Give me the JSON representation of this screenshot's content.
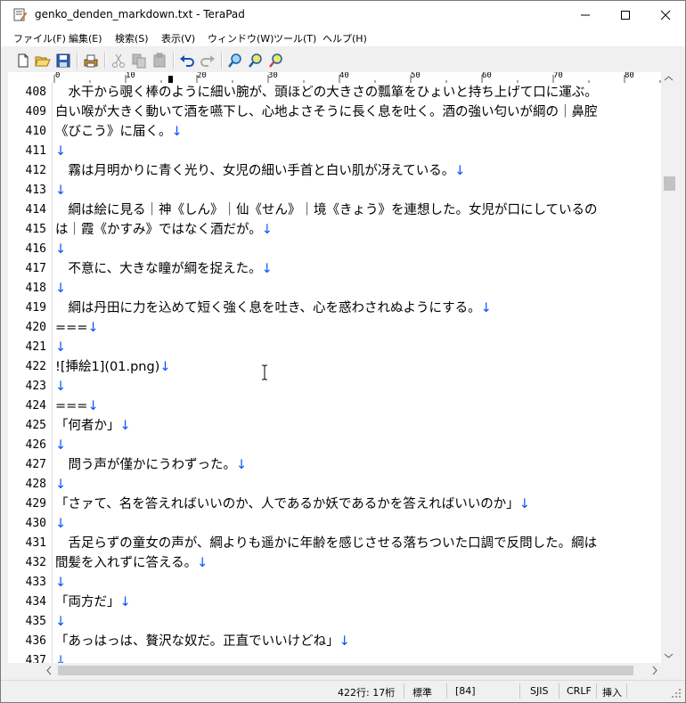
{
  "window": {
    "title": "genko_denden_markdown.txt - TeraPad",
    "buttons": {
      "minimize": "─",
      "maximize": "☐",
      "close": "✕"
    }
  },
  "menu": {
    "items": [
      {
        "label": "ファイル(F)"
      },
      {
        "label": "編集(E)"
      },
      {
        "label": "検索(S)"
      },
      {
        "label": "表示(V)"
      },
      {
        "label": "ウィンドウ(W)"
      },
      {
        "label": "ツール(T)"
      },
      {
        "label": "ヘルプ(H)"
      }
    ]
  },
  "toolbar": {
    "icons": [
      "new-file-icon",
      "open-folder-icon",
      "save-icon",
      "print-icon",
      "cut-icon",
      "copy-icon",
      "paste-icon",
      "undo-icon",
      "redo-icon",
      "search-icon",
      "search-next-icon",
      "search-prev-icon"
    ]
  },
  "ruler": {
    "ticks": [
      "0",
      "10",
      "20",
      "30",
      "40",
      "50",
      "60",
      "70",
      "80"
    ]
  },
  "editor": {
    "lines": [
      {
        "num": "408",
        "text": "　水干から覗く棒のように細い腕が、頭ほどの大きさの瓢箪をひょいと持ち上げて口に運ぶ。",
        "mark": ""
      },
      {
        "num": "409",
        "text": "白い喉が大きく動いて酒を嚥下し、心地よさそうに長く息を吐く。酒の強い匂いが綱の｜鼻腔",
        "mark": ""
      },
      {
        "num": "410",
        "text": "《びこう》に届く。",
        "mark": "↓"
      },
      {
        "num": "411",
        "text": "",
        "mark": "↓"
      },
      {
        "num": "412",
        "text": "　霧は月明かりに青く光り、女児の細い手首と白い肌が冴えている。",
        "mark": "↓"
      },
      {
        "num": "413",
        "text": "",
        "mark": "↓"
      },
      {
        "num": "414",
        "text": "　綱は絵に見る｜神《しん》｜仙《せん》｜境《きょう》を連想した。女児が口にしているの",
        "mark": ""
      },
      {
        "num": "415",
        "text": "は｜霞《かすみ》ではなく酒だが。",
        "mark": "↓"
      },
      {
        "num": "416",
        "text": "",
        "mark": "↓"
      },
      {
        "num": "417",
        "text": "　不意に、大きな瞳が綱を捉えた。",
        "mark": "↓"
      },
      {
        "num": "418",
        "text": "",
        "mark": "↓"
      },
      {
        "num": "419",
        "text": "　綱は丹田に力を込めて短く強く息を吐き、心を惑わされぬようにする。",
        "mark": "↓"
      },
      {
        "num": "420",
        "text": "===",
        "mark": "↓"
      },
      {
        "num": "421",
        "text": "",
        "mark": "↓"
      },
      {
        "num": "422",
        "text": "![挿絵1](01.png)",
        "mark": "↓"
      },
      {
        "num": "423",
        "text": "",
        "mark": "↓"
      },
      {
        "num": "424",
        "text": "===",
        "mark": "↓"
      },
      {
        "num": "425",
        "text": "「何者か」",
        "mark": "↓"
      },
      {
        "num": "426",
        "text": "",
        "mark": "↓"
      },
      {
        "num": "427",
        "text": "　問う声が僅かにうわずった。",
        "mark": "↓"
      },
      {
        "num": "428",
        "text": "",
        "mark": "↓"
      },
      {
        "num": "429",
        "text": "「さァて、名を答えればいいのか、人であるか妖であるかを答えればいいのか」",
        "mark": "↓"
      },
      {
        "num": "430",
        "text": "",
        "mark": "↓"
      },
      {
        "num": "431",
        "text": "　舌足らずの童女の声が、綱よりも遥かに年齢を感じさせる落ちついた口調で反問した。綱は",
        "mark": ""
      },
      {
        "num": "432",
        "text": "間髪を入れずに答える。",
        "mark": "↓"
      },
      {
        "num": "433",
        "text": "",
        "mark": "↓"
      },
      {
        "num": "434",
        "text": "「両方だ」",
        "mark": "↓"
      },
      {
        "num": "435",
        "text": "",
        "mark": "↓"
      },
      {
        "num": "436",
        "text": "「あっはっは、贅沢な奴だ。正直でいいけどね」",
        "mark": "↓"
      },
      {
        "num": "437",
        "text": "",
        "mark": "↓"
      }
    ]
  },
  "status": {
    "position": "422行: 17桁",
    "mode": "標準",
    "code": "[84]",
    "encoding": "SJIS",
    "newline": "CRLF",
    "insert": "挿入"
  }
}
